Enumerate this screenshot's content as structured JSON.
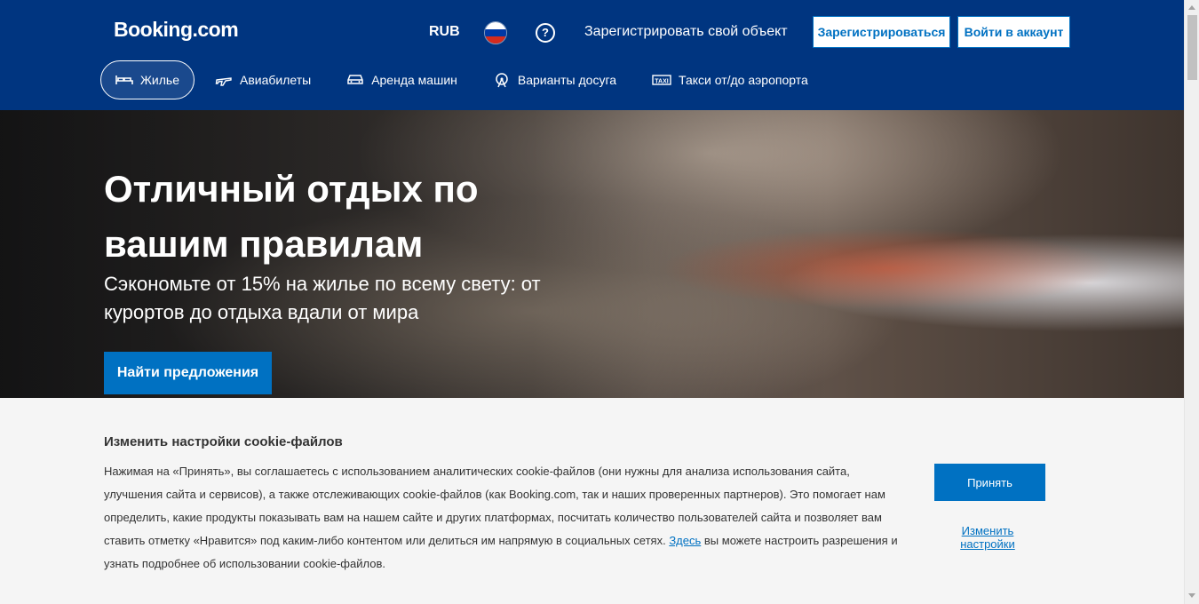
{
  "header": {
    "logo": "Booking.com",
    "currency": "RUB",
    "help_icon": "question-icon",
    "list_property": "Зарегистрировать свой объект",
    "register": "Зарегистрироваться",
    "sign_in": "Войти в аккаунт"
  },
  "nav": {
    "items": [
      {
        "label": "Жилье",
        "icon": "bed-icon",
        "active": true
      },
      {
        "label": "Авиабилеты",
        "icon": "plane-icon",
        "active": false
      },
      {
        "label": "Аренда машин",
        "icon": "car-icon",
        "active": false
      },
      {
        "label": "Варианты досуга",
        "icon": "attractions-icon",
        "active": false
      },
      {
        "label": "Такси от/до аэропорта",
        "icon": "taxi-icon",
        "active": false
      }
    ]
  },
  "hero": {
    "title": "Отличный отдых по вашим правилам",
    "subtitle": "Сэкономьте от 15% на жилье по всему свету: от курортов до отдыха вдали от мира",
    "cta": "Найти предложения"
  },
  "cookie": {
    "title": "Изменить настройки cookie-файлов",
    "text_before_link": "Нажимая на «Принять», вы соглашаетесь с использованием аналитических cookie-файлов (они нужны для анализа использования сайта, улучшения сайта и сервисов), а также отслеживающих cookie-файлов (как Booking.com, так и наших проверенных партнеров). Это помогает нам определить, какие продукты показывать вам на нашем сайте и других платформах, посчитать количество пользователей сайта и позволяет вам ставить отметку «Нравится» под каким-либо контентом или делиться им напрямую в социальных сетях.",
    "link": "Здесь",
    "text_after_link": "вы можете настроить разрешения и узнать подробнее об использовании cookie-файлов.",
    "accept": "Принять",
    "settings": "Изменить настройки"
  },
  "colors": {
    "brand": "#003580",
    "accent": "#0071c2"
  }
}
